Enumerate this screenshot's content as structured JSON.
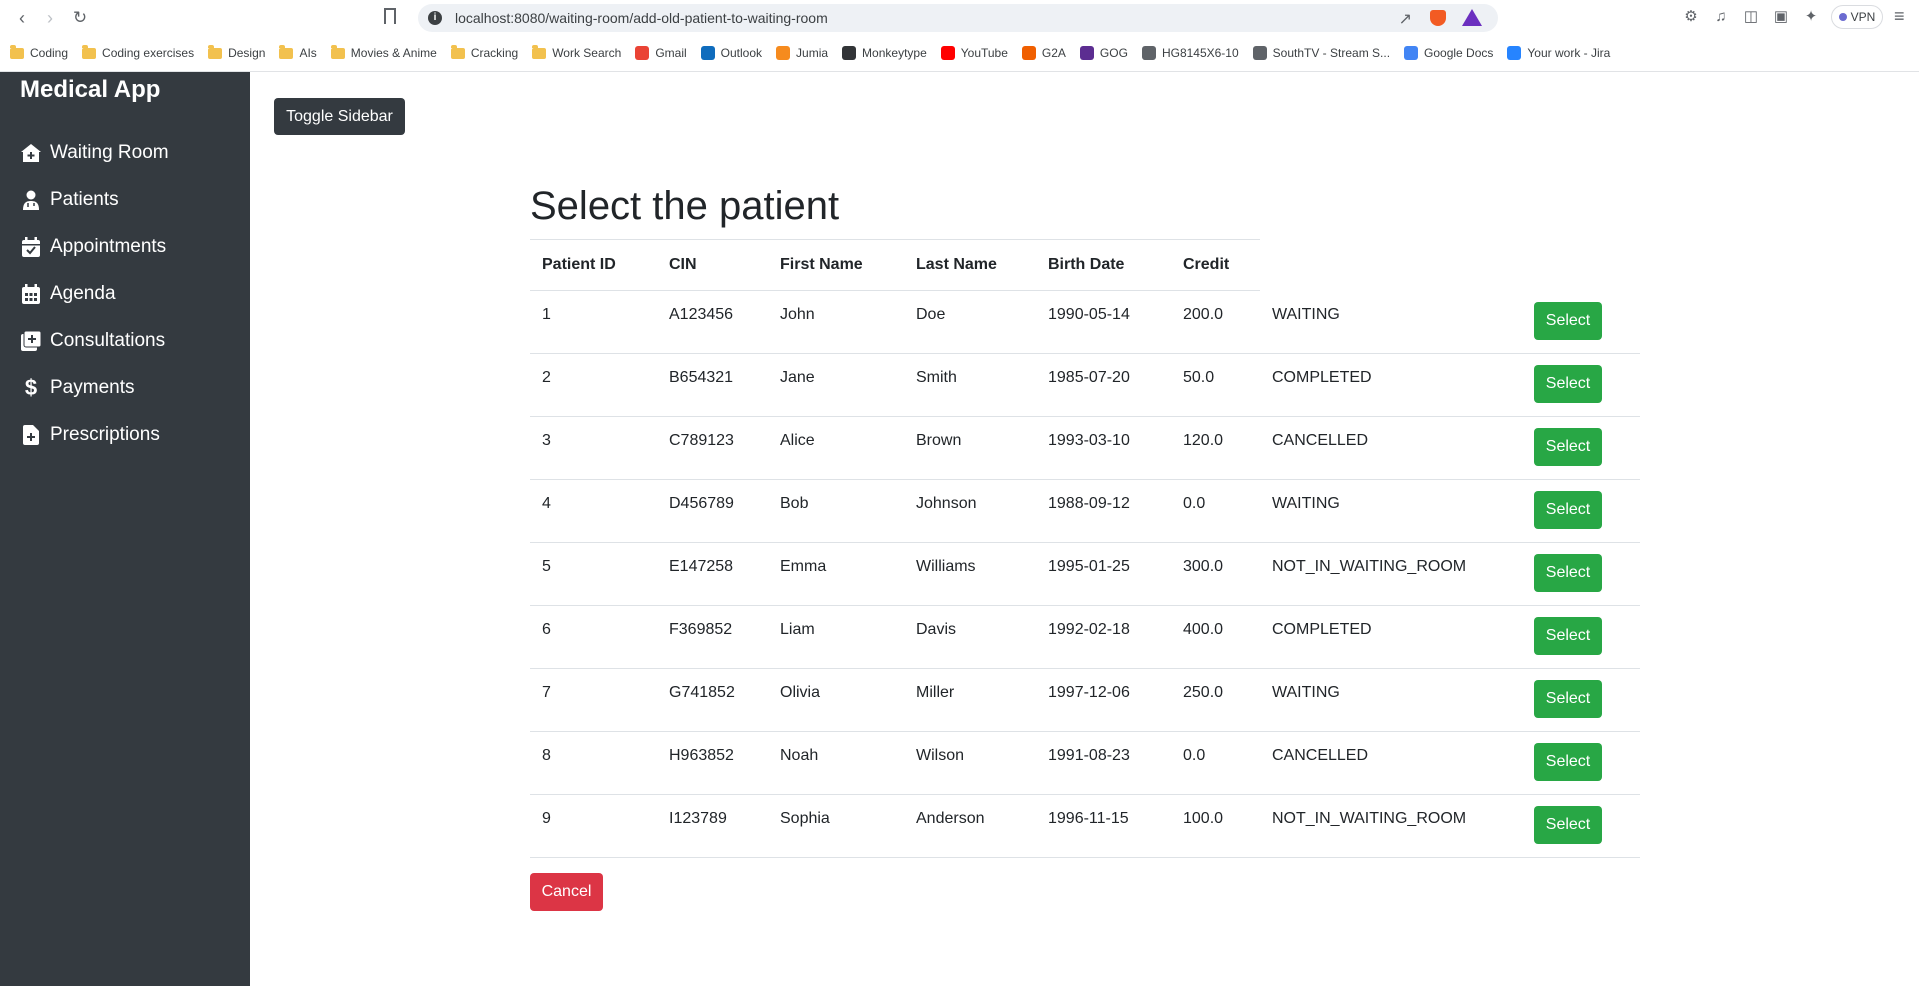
{
  "browser": {
    "url": "localhost:8080/waiting-room/add-old-patient-to-waiting-room",
    "vpn_label": "VPN",
    "bookmarks": [
      {
        "label": "Coding",
        "icon": "folder-icon",
        "color": "#f2c14e"
      },
      {
        "label": "Coding exercises",
        "icon": "folder-icon",
        "color": "#f2c14e"
      },
      {
        "label": "Design",
        "icon": "folder-icon",
        "color": "#f2c14e"
      },
      {
        "label": "AIs",
        "icon": "folder-icon",
        "color": "#f2c14e"
      },
      {
        "label": "Movies & Anime",
        "icon": "folder-icon",
        "color": "#f2c14e"
      },
      {
        "label": "Cracking",
        "icon": "folder-icon",
        "color": "#f2c14e"
      },
      {
        "label": "Work Search",
        "icon": "folder-icon",
        "color": "#f2c14e"
      },
      {
        "label": "Gmail",
        "icon": "gmail-icon",
        "color": "#ea4335"
      },
      {
        "label": "Outlook",
        "icon": "outlook-icon",
        "color": "#0f6cbd"
      },
      {
        "label": "Jumia",
        "icon": "jumia-icon",
        "color": "#f68b1e"
      },
      {
        "label": "Monkeytype",
        "icon": "monkeytype-icon",
        "color": "#323437"
      },
      {
        "label": "YouTube",
        "icon": "youtube-icon",
        "color": "#ff0000"
      },
      {
        "label": "G2A",
        "icon": "g2a-icon",
        "color": "#f05f00"
      },
      {
        "label": "GOG",
        "icon": "gog-icon",
        "color": "#5c2d91"
      },
      {
        "label": "HG8145X6-10",
        "icon": "globe-icon",
        "color": "#5f6368"
      },
      {
        "label": "SouthTV - Stream S...",
        "icon": "globe-icon",
        "color": "#5f6368"
      },
      {
        "label": "Google Docs",
        "icon": "docs-icon",
        "color": "#4285f4"
      },
      {
        "label": "Your work - Jira",
        "icon": "jira-icon",
        "color": "#2684ff"
      }
    ]
  },
  "sidebar": {
    "brand": "Medical App",
    "items": [
      {
        "label": "Waiting Room",
        "icon": "house-medical-icon"
      },
      {
        "label": "Patients",
        "icon": "user-doctor-icon"
      },
      {
        "label": "Appointments",
        "icon": "calendar-check-icon"
      },
      {
        "label": "Agenda",
        "icon": "calendar-icon"
      },
      {
        "label": "Consultations",
        "icon": "notes-medical-icon"
      },
      {
        "label": "Payments",
        "icon": "dollar-icon"
      },
      {
        "label": "Prescriptions",
        "icon": "file-medical-icon"
      }
    ]
  },
  "main": {
    "toggle_label": "Toggle Sidebar",
    "title": "Select the patient",
    "columns": [
      "Patient ID",
      "CIN",
      "First Name",
      "Last Name",
      "Birth Date",
      "Credit"
    ],
    "select_label": "Select",
    "cancel_label": "Cancel",
    "rows": [
      {
        "id": "1",
        "cin": "A123456",
        "first": "John",
        "last": "Doe",
        "birth": "1990-05-14",
        "credit": "200.0",
        "status": "WAITING"
      },
      {
        "id": "2",
        "cin": "B654321",
        "first": "Jane",
        "last": "Smith",
        "birth": "1985-07-20",
        "credit": "50.0",
        "status": "COMPLETED"
      },
      {
        "id": "3",
        "cin": "C789123",
        "first": "Alice",
        "last": "Brown",
        "birth": "1993-03-10",
        "credit": "120.0",
        "status": "CANCELLED"
      },
      {
        "id": "4",
        "cin": "D456789",
        "first": "Bob",
        "last": "Johnson",
        "birth": "1988-09-12",
        "credit": "0.0",
        "status": "WAITING"
      },
      {
        "id": "5",
        "cin": "E147258",
        "first": "Emma",
        "last": "Williams",
        "birth": "1995-01-25",
        "credit": "300.0",
        "status": "NOT_IN_WAITING_ROOM"
      },
      {
        "id": "6",
        "cin": "F369852",
        "first": "Liam",
        "last": "Davis",
        "birth": "1992-02-18",
        "credit": "400.0",
        "status": "COMPLETED"
      },
      {
        "id": "7",
        "cin": "G741852",
        "first": "Olivia",
        "last": "Miller",
        "birth": "1997-12-06",
        "credit": "250.0",
        "status": "WAITING"
      },
      {
        "id": "8",
        "cin": "H963852",
        "first": "Noah",
        "last": "Wilson",
        "birth": "1991-08-23",
        "credit": "0.0",
        "status": "CANCELLED"
      },
      {
        "id": "9",
        "cin": "I123789",
        "first": "Sophia",
        "last": "Anderson",
        "birth": "1996-11-15",
        "credit": "100.0",
        "status": "NOT_IN_WAITING_ROOM"
      }
    ]
  },
  "colors": {
    "sidebar_bg": "#343a40",
    "select_btn": "#28a745",
    "cancel_btn": "#dc3545"
  }
}
